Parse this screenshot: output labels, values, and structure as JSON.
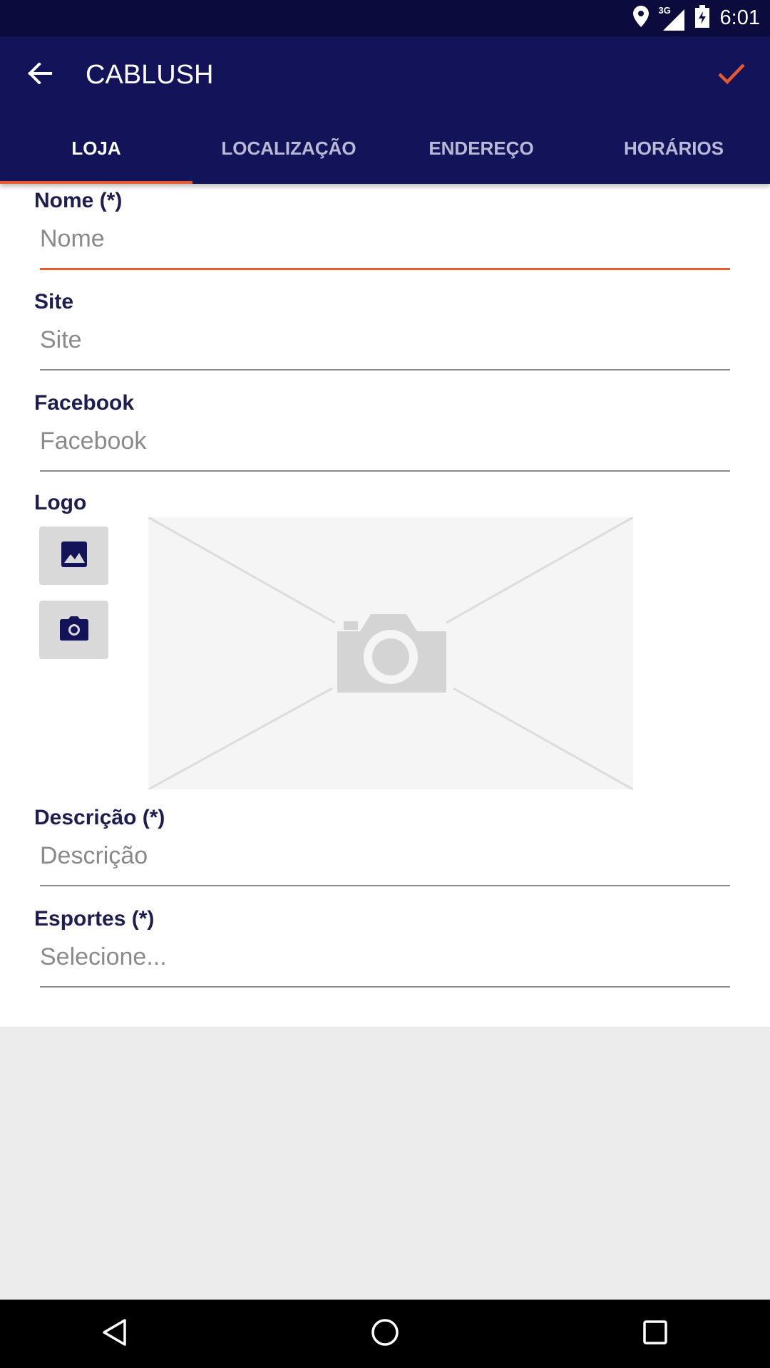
{
  "status_bar": {
    "time": "6:01",
    "network_label": "3G",
    "icons": [
      "location-icon",
      "signal-icon",
      "battery-icon"
    ]
  },
  "app_bar": {
    "title": "CABLUSH",
    "back_icon": "arrow-back-icon",
    "confirm_icon": "check-icon"
  },
  "tabs": [
    {
      "label": "LOJA",
      "active": true
    },
    {
      "label": "LOCALIZAÇÃO",
      "active": false
    },
    {
      "label": "ENDEREÇO",
      "active": false
    },
    {
      "label": "HORÁRIOS",
      "active": false
    }
  ],
  "form": {
    "nome": {
      "label": "Nome (*)",
      "placeholder": "Nome"
    },
    "site": {
      "label": "Site",
      "placeholder": "Site"
    },
    "facebook": {
      "label": "Facebook",
      "placeholder": "Facebook"
    },
    "logo": {
      "label": "Logo",
      "gallery_icon": "image-icon",
      "camera_icon": "camera-icon",
      "placeholder_icon": "photo-placeholder-icon"
    },
    "descricao": {
      "label": "Descrição (*)",
      "placeholder": "Descrição"
    },
    "esportes": {
      "label": "Esportes (*)",
      "placeholder": "Selecione..."
    }
  },
  "nav_bar": {
    "icons": [
      "back-triangle-icon",
      "home-circle-icon",
      "recents-square-icon"
    ]
  },
  "colors": {
    "status_bar": "#0b0b3d",
    "primary": "#13135a",
    "accent": "#e85a2c",
    "label": "#1d1d4f",
    "hint": "#8a8a8a"
  }
}
